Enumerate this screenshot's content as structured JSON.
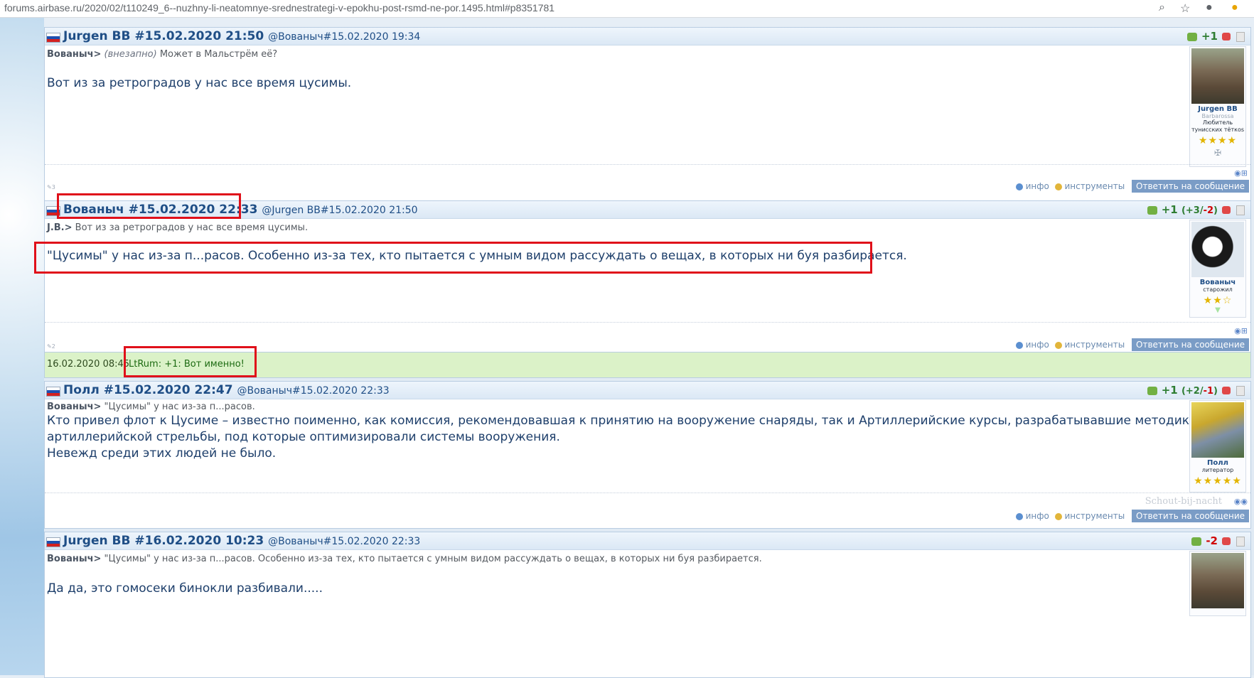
{
  "browser": {
    "url": "forums.airbase.ru/2020/02/t110249_6--nuzhny-li-neatomnye-srednestrategi-v-epokhu-post-rsmd-ne-por.1495.html#p8351781"
  },
  "common": {
    "info_label": "инфо",
    "tools_label": "инструменты",
    "reply_label": "Ответить на сообщение"
  },
  "posts": [
    {
      "author": "Jurgen BB",
      "anchor": "#15.02.2020 21:50",
      "reply_to": "@Вованыч#15.02.2020 19:34",
      "rating": "+1",
      "quote_author": "Вованыч>",
      "quote_italic": "(внезапно)",
      "quote_text": "Может в Мальстрём её?",
      "body_lines": [
        "Вот из за ретроградов у нас все время цусимы."
      ],
      "avatar": {
        "name": "Jurgen BB",
        "sub1": "Barbarossa",
        "sub2": "Любитель тунисских тёткоs",
        "stars": "★★★★"
      },
      "reply_count": "3"
    },
    {
      "author": "Вованыч",
      "anchor": "#15.02.2020 22:33",
      "reply_to": "@Jurgen BB#15.02.2020 21:50",
      "rating": "+1",
      "rating_detail_prefix": "(",
      "rating_plus": "+3",
      "rating_sep": "/",
      "rating_minus": "-2",
      "rating_detail_suffix": ")",
      "quote_author": "J.B.>",
      "quote_text": "Вот из за ретроградов у нас все время цусимы.",
      "body_lines": [
        "\"Цусимы\" у нас из-за п...расов. Особенно из-за тех, кто пытается с умным видом рассуждать о вещах, в которых ни буя разбирается."
      ],
      "avatar": {
        "name": "Вованыч",
        "sub2": "старожил",
        "stars": "★★☆"
      },
      "reply_count": "2"
    },
    {
      "author": "Полл",
      "anchor": "#15.02.2020 22:47",
      "reply_to": "@Вованыч#15.02.2020 22:33",
      "rating": "+1",
      "rating_detail_prefix": "(",
      "rating_plus": "+2",
      "rating_sep": "/",
      "rating_minus": "-1",
      "rating_detail_suffix": ")",
      "quote_author": "Вованыч>",
      "quote_text": "\"Цусимы\" у нас из-за п...расов.",
      "body_lines": [
        "Кто привел флот к Цусиме – известно поименно, как комиссия, рекомендовавшая к принятию на вооружение снаряды, так и Артиллерийские курсы, разрабатывавшие методики",
        "артиллерийской стрельбы, под которые оптимизировали системы вооружения.",
        "Невежд среди этих людей не было."
      ],
      "avatar": {
        "name": "Полл",
        "sub2": "литератор",
        "stars": "★★★★★"
      },
      "signature": "Schout-bij-nacht"
    },
    {
      "author": "Jurgen BB",
      "anchor": "#16.02.2020 10:23",
      "reply_to": "@Вованыч#15.02.2020 22:33",
      "rating": "-2",
      "quote_author": "Вованыч>",
      "quote_text": "\"Цусимы\" у нас из-за п...расов. Особенно из-за тех, кто пытается с умным видом рассуждать о вещах, в которых ни буя разбирается.",
      "body_lines": [
        "Да да, это гомосеки бинокли разбивали....."
      ]
    }
  ],
  "comment": {
    "date": "16.02.2020 08:45",
    "text": "LtRum: +1: Вот именно!"
  }
}
